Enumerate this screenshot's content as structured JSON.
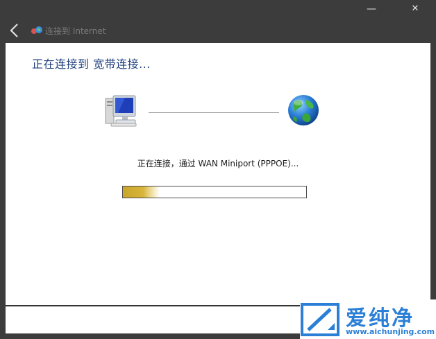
{
  "window": {
    "minimize_glyph": "—",
    "close_glyph": "✕",
    "back_icon": "back-arrow-icon",
    "app_icon": "network-connection-icon",
    "title": "连接到 Internet"
  },
  "main": {
    "heading": "正在连接到 宽带连接...",
    "computer_icon": "computer-icon",
    "globe_icon": "globe-icon",
    "status_text": "正在连接，通过 WAN Miniport (PPPOE)...",
    "progress_percent": 20,
    "progress_color": "#c9a52a"
  },
  "watermark": {
    "name": "爱纯净",
    "url": "www.aichunjing.com",
    "color": "#2b7fd6"
  }
}
